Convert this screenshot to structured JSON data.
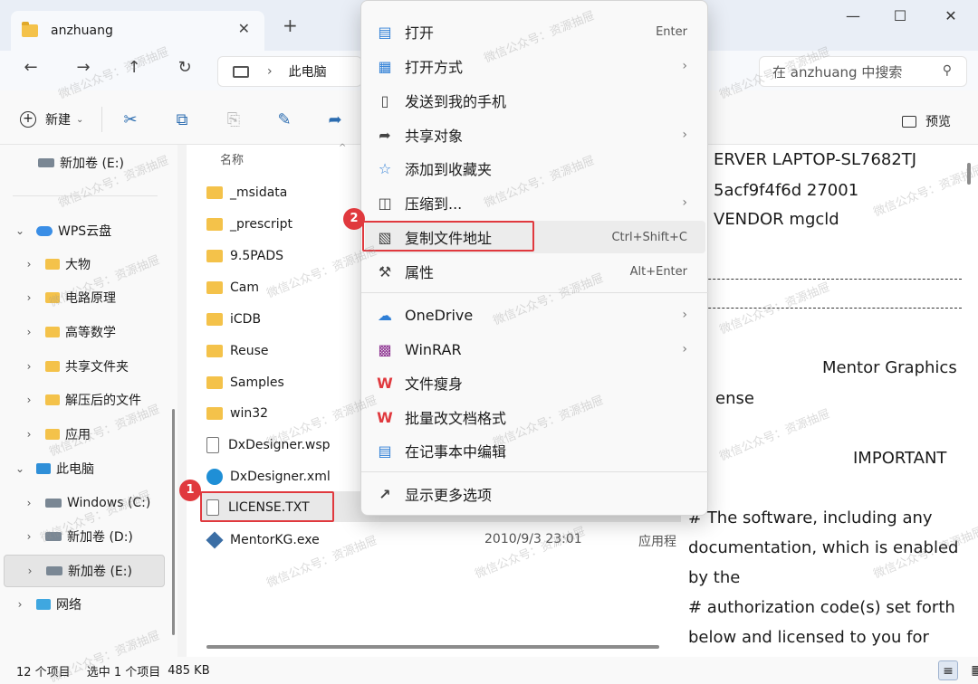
{
  "window": {
    "tab_title": "anzhuang",
    "tab_close": "✕",
    "new_tab": "+",
    "minimize": "—",
    "maximize": "☐",
    "close": "✕"
  },
  "nav": {
    "back": "←",
    "forward": "→",
    "up": "↑",
    "refresh": "↻",
    "address_chevron": "›",
    "address_text": "此电脑",
    "search_placeholder": "在 anzhuang 中搜索",
    "search_icon": "search-icon"
  },
  "toolbar": {
    "new_label": "新建",
    "new_dropdown": "⌄",
    "preview_label": "预览"
  },
  "sidebar": {
    "items": [
      {
        "label": "新加卷 (E:)",
        "icon": "drive-icon"
      },
      {
        "label": "WPS云盘",
        "icon": "cloud-icon"
      },
      {
        "label": "大物",
        "icon": "folder-icon"
      },
      {
        "label": "电路原理",
        "icon": "folder-icon"
      },
      {
        "label": "高等数学",
        "icon": "folder-icon"
      },
      {
        "label": "共享文件夹",
        "icon": "folder-icon"
      },
      {
        "label": "解压后的文件",
        "icon": "folder-icon"
      },
      {
        "label": "应用",
        "icon": "folder-icon"
      },
      {
        "label": "此电脑",
        "icon": "pc-icon"
      },
      {
        "label": "Windows (C:)",
        "icon": "drive-icon"
      },
      {
        "label": "新加卷 (D:)",
        "icon": "drive-icon"
      },
      {
        "label": "新加卷 (E:)",
        "icon": "drive-icon"
      },
      {
        "label": "网络",
        "icon": "network-icon"
      }
    ],
    "expand_arrow": "›",
    "collapse_arrow": "⌄"
  },
  "filelist": {
    "column_name": "名称",
    "sort_indicator": "^",
    "files": [
      {
        "name": "_msidata",
        "type": "folder"
      },
      {
        "name": "_prescript",
        "type": "folder"
      },
      {
        "name": "9.5PADS",
        "type": "folder"
      },
      {
        "name": "Cam",
        "type": "folder"
      },
      {
        "name": "iCDB",
        "type": "folder"
      },
      {
        "name": "Reuse",
        "type": "folder"
      },
      {
        "name": "Samples",
        "type": "folder"
      },
      {
        "name": "win32",
        "type": "folder"
      },
      {
        "name": "DxDesigner.wsp",
        "type": "doc"
      },
      {
        "name": "DxDesigner.xml",
        "type": "edge"
      },
      {
        "name": "LICENSE.TXT",
        "type": "doc"
      },
      {
        "name": "MentorKG.exe",
        "type": "exe",
        "date": "2010/9/3 23:01",
        "kind": "应用程"
      }
    ]
  },
  "preview": {
    "lines": [
      "ERVER LAPTOP-SL7682TJ",
      "5acf9f4f6d 27001",
      "VENDOR mgcld",
      "Mentor Graphics",
      "ense",
      "IMPORTANT",
      "# The software, including any",
      "documentation, which is enabled",
      "by the",
      "# authorization code(s) set  forth",
      "below and  licensed to you  for"
    ]
  },
  "statusbar": {
    "count": "12 个项目",
    "selection": "选中 1 个项目",
    "size": "485 KB"
  },
  "context_menu": {
    "items": [
      {
        "label": "打开",
        "shortcut": "Enter",
        "icon": "notepad-icon"
      },
      {
        "label": "打开方式",
        "submenu": "›",
        "icon": "open-with-icon"
      },
      {
        "label": "发送到我的手机",
        "icon": "phone-icon"
      },
      {
        "label": "共享对象",
        "submenu": "›",
        "icon": "share-icon"
      },
      {
        "label": "添加到收藏夹",
        "icon": "star-icon"
      },
      {
        "label": "压缩到...",
        "submenu": "›",
        "icon": "zip-icon"
      },
      {
        "label": "复制文件地址",
        "shortcut": "Ctrl+Shift+C",
        "icon": "copy-path-icon"
      },
      {
        "label": "属性",
        "shortcut": "Alt+Enter",
        "icon": "wrench-icon"
      },
      {
        "label": "OneDrive",
        "submenu": "›",
        "icon": "onedrive-icon"
      },
      {
        "label": "WinRAR",
        "submenu": "›",
        "icon": "winrar-icon"
      },
      {
        "label": "文件瘦身",
        "icon": "wps-icon"
      },
      {
        "label": "批量改文档格式",
        "icon": "wps-icon"
      },
      {
        "label": "在记事本中编辑",
        "icon": "notepad-icon"
      },
      {
        "label": "显示更多选项",
        "icon": "more-options-icon"
      }
    ]
  },
  "annotations": {
    "badge_1": "1",
    "badge_2": "2",
    "color": "#e0393e"
  },
  "watermark": "微信公众号：资源抽屉"
}
